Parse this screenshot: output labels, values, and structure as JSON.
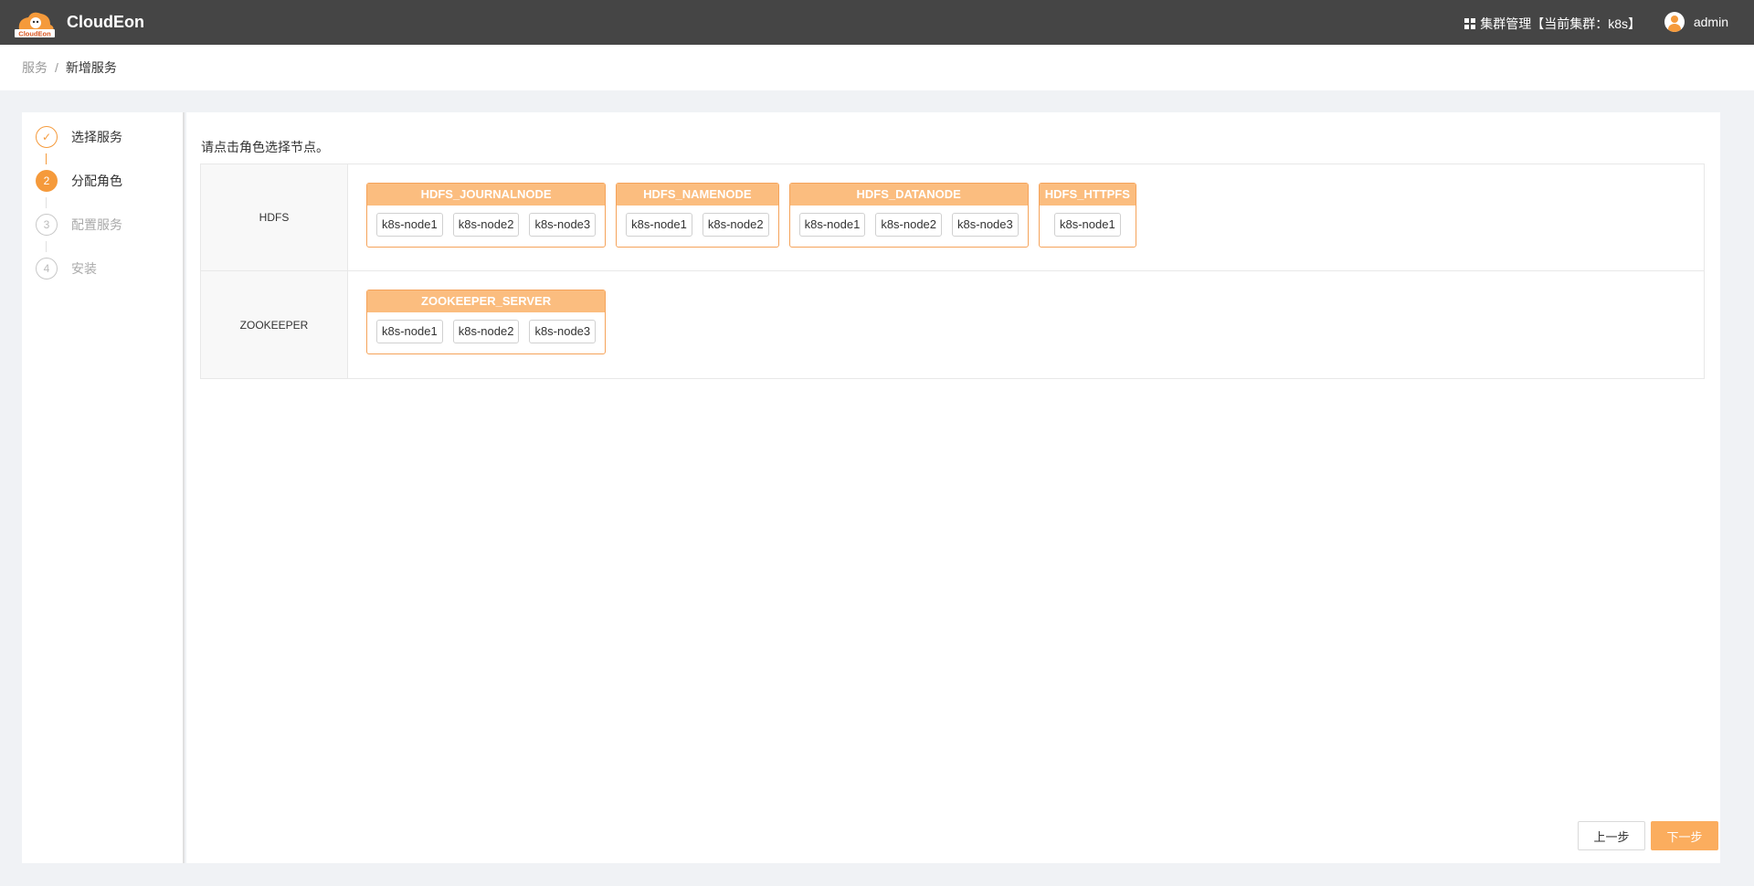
{
  "header": {
    "app_title": "CloudEon",
    "logo_text": "CloudEon",
    "cluster_menu_label": "集群管理【当前集群：k8s】",
    "user_name": "admin"
  },
  "breadcrumb": {
    "parent": "服务",
    "separator": "/",
    "current": "新增服务"
  },
  "steps": [
    {
      "number": "✓",
      "label": "选择服务",
      "state": "done"
    },
    {
      "number": "2",
      "label": "分配角色",
      "state": "active"
    },
    {
      "number": "3",
      "label": "配置服务",
      "state": "wait"
    },
    {
      "number": "4",
      "label": "安装",
      "state": "wait"
    }
  ],
  "main": {
    "instruction": "请点击角色选择节点。",
    "services": [
      {
        "name": "HDFS",
        "roles": [
          {
            "name": "HDFS_JOURNALNODE",
            "nodes": [
              "k8s-node1",
              "k8s-node2",
              "k8s-node3"
            ]
          },
          {
            "name": "HDFS_NAMENODE",
            "nodes": [
              "k8s-node1",
              "k8s-node2"
            ]
          },
          {
            "name": "HDFS_DATANODE",
            "nodes": [
              "k8s-node1",
              "k8s-node2",
              "k8s-node3"
            ]
          },
          {
            "name": "HDFS_HTTPFS",
            "nodes": [
              "k8s-node1"
            ]
          }
        ]
      },
      {
        "name": "ZOOKEEPER",
        "roles": [
          {
            "name": "ZOOKEEPER_SERVER",
            "nodes": [
              "k8s-node1",
              "k8s-node2",
              "k8s-node3"
            ]
          }
        ]
      }
    ]
  },
  "footer": {
    "prev_label": "上一步",
    "next_label": "下一步"
  },
  "colors": {
    "header_bg": "#454545",
    "accent": "#f59a3b",
    "role_header": "#fbbd7f",
    "next_button": "#fbad5e"
  }
}
